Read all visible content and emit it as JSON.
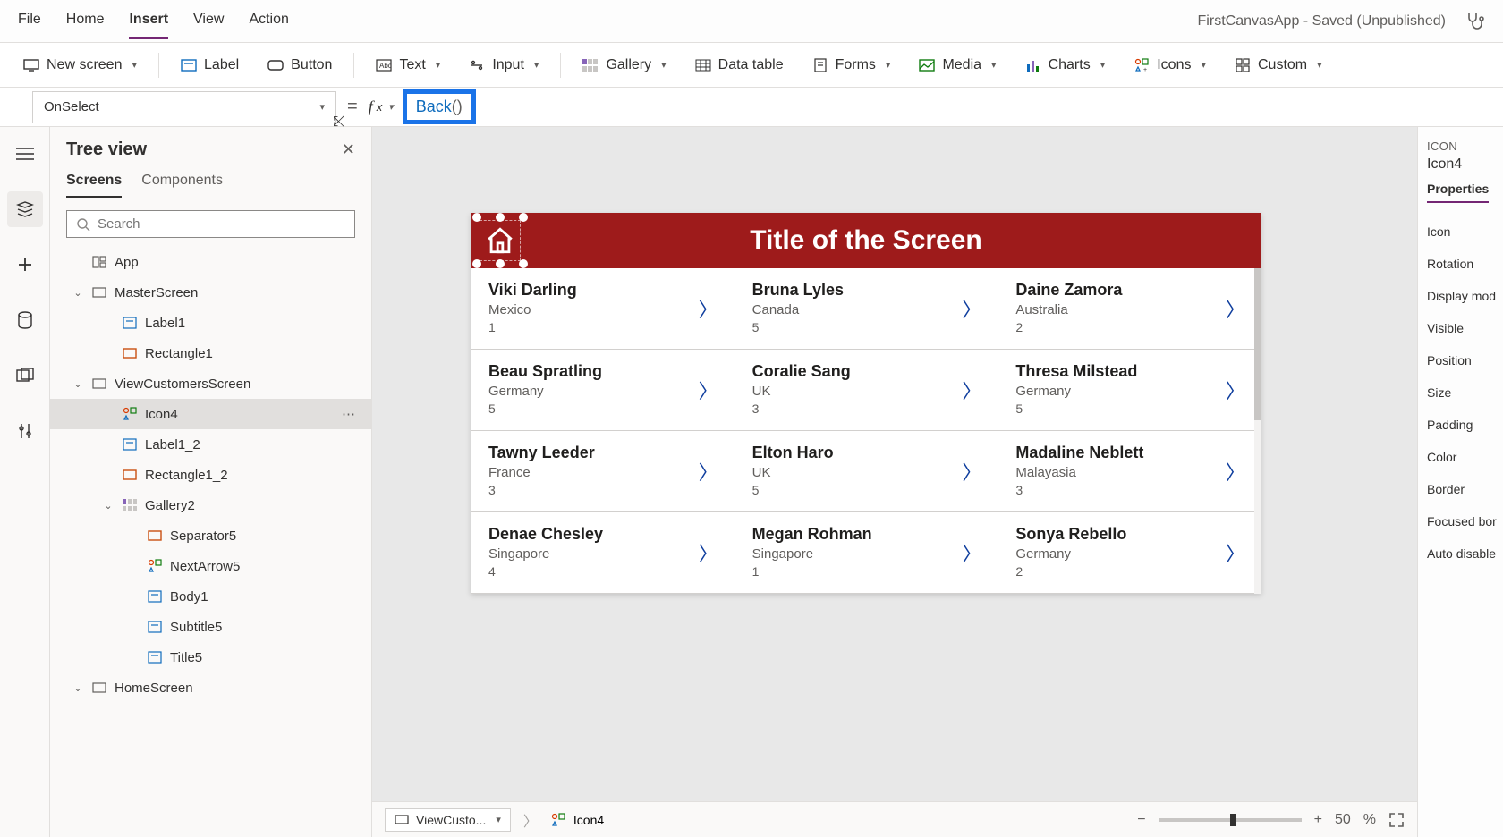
{
  "menubar": {
    "items": [
      "File",
      "Home",
      "Insert",
      "View",
      "Action"
    ],
    "active_index": 2,
    "app_status": "FirstCanvasApp - Saved (Unpublished)"
  },
  "ribbon": {
    "new_screen": "New screen",
    "label": "Label",
    "button": "Button",
    "text": "Text",
    "input": "Input",
    "gallery": "Gallery",
    "data_table": "Data table",
    "forms": "Forms",
    "media": "Media",
    "charts": "Charts",
    "icons": "Icons",
    "custom": "Custom"
  },
  "formula": {
    "property": "OnSelect",
    "fn": "Back",
    "paren": "()"
  },
  "treeview": {
    "title": "Tree view",
    "tabs": [
      "Screens",
      "Components"
    ],
    "search_placeholder": "Search",
    "items": [
      {
        "label": "App",
        "level": 1,
        "icon": "app"
      },
      {
        "label": "MasterScreen",
        "level": 1,
        "icon": "screen",
        "caret": true
      },
      {
        "label": "Label1",
        "level": 2,
        "icon": "label"
      },
      {
        "label": "Rectangle1",
        "level": 2,
        "icon": "rect"
      },
      {
        "label": "ViewCustomersScreen",
        "level": 1,
        "icon": "screen",
        "caret": true
      },
      {
        "label": "Icon4",
        "level": 2,
        "icon": "iconctl",
        "selected": true
      },
      {
        "label": "Label1_2",
        "level": 2,
        "icon": "label"
      },
      {
        "label": "Rectangle1_2",
        "level": 2,
        "icon": "rect"
      },
      {
        "label": "Gallery2",
        "level": 2,
        "icon": "gallery",
        "caret": true
      },
      {
        "label": "Separator5",
        "level": 3,
        "icon": "rect"
      },
      {
        "label": "NextArrow5",
        "level": 3,
        "icon": "iconctl"
      },
      {
        "label": "Body1",
        "level": 3,
        "icon": "label"
      },
      {
        "label": "Subtitle5",
        "level": 3,
        "icon": "label"
      },
      {
        "label": "Title5",
        "level": 3,
        "icon": "label"
      },
      {
        "label": "HomeScreen",
        "level": 1,
        "icon": "screen",
        "caret": true
      }
    ]
  },
  "canvas": {
    "title": "Title of the Screen",
    "header_bg": "#9e1b1b",
    "gallery": [
      {
        "name": "Viki Darling",
        "country": "Mexico",
        "num": "1"
      },
      {
        "name": "Bruna Lyles",
        "country": "Canada",
        "num": "5"
      },
      {
        "name": "Daine Zamora",
        "country": "Australia",
        "num": "2"
      },
      {
        "name": "Beau Spratling",
        "country": "Germany",
        "num": "5"
      },
      {
        "name": "Coralie Sang",
        "country": "UK",
        "num": "3"
      },
      {
        "name": "Thresa Milstead",
        "country": "Germany",
        "num": "5"
      },
      {
        "name": "Tawny Leeder",
        "country": "France",
        "num": "3"
      },
      {
        "name": "Elton Haro",
        "country": "UK",
        "num": "5"
      },
      {
        "name": "Madaline Neblett",
        "country": "Malayasia",
        "num": "3"
      },
      {
        "name": "Denae Chesley",
        "country": "Singapore",
        "num": "4"
      },
      {
        "name": "Megan Rohman",
        "country": "Singapore",
        "num": "1"
      },
      {
        "name": "Sonya Rebello",
        "country": "Germany",
        "num": "2"
      }
    ]
  },
  "breadcrumb": {
    "screen": "ViewCusto...",
    "control": "Icon4"
  },
  "zoom": {
    "minus": "−",
    "plus": "+",
    "value": "50",
    "pct": "%"
  },
  "props": {
    "type_label": "ICON",
    "name": "Icon4",
    "tab": "Properties",
    "rows": [
      "Icon",
      "Rotation",
      "Display mod",
      "Visible",
      "Position",
      "Size",
      "Padding",
      "Color",
      "Border",
      "Focused bor",
      "Auto disable"
    ]
  }
}
